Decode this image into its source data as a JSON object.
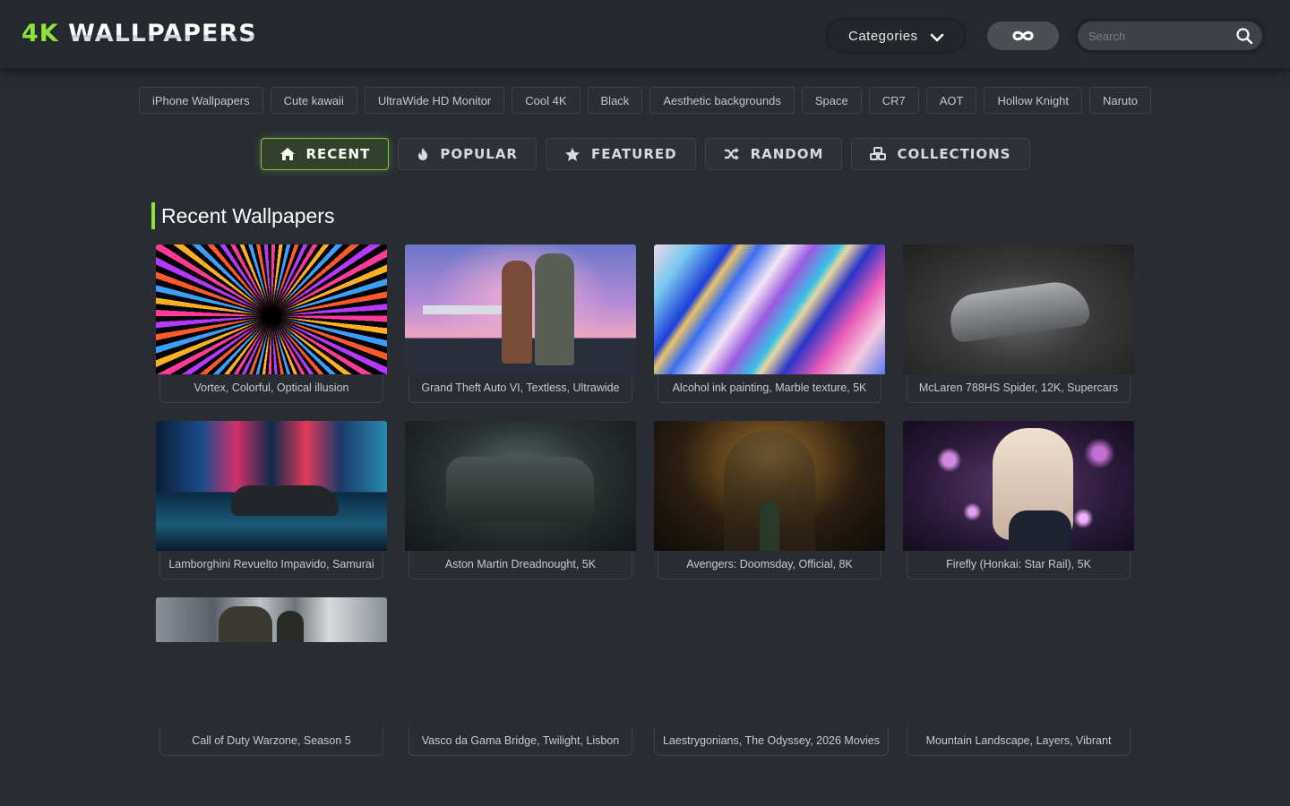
{
  "header": {
    "logo_accent": "4K",
    "logo_rest": "WALLPAPERS",
    "categories_label": "Categories",
    "search_placeholder": "Search"
  },
  "tags": [
    "iPhone Wallpapers",
    "Cute kawaii",
    "UltraWide HD Monitor",
    "Cool 4K",
    "Black",
    "Aesthetic backgrounds",
    "Space",
    "CR7",
    "AOT",
    "Hollow Knight",
    "Naruto"
  ],
  "nav_tabs": [
    {
      "label": "RECENT",
      "icon": "home-icon",
      "active": true
    },
    {
      "label": "POPULAR",
      "icon": "fire-icon",
      "active": false
    },
    {
      "label": "FEATURED",
      "icon": "star-icon",
      "active": false
    },
    {
      "label": "RANDOM",
      "icon": "shuffle-icon",
      "active": false
    },
    {
      "label": "COLLECTIONS",
      "icon": "collections-icon",
      "active": false
    }
  ],
  "section_title": "Recent Wallpapers",
  "wallpapers": [
    {
      "title": "Vortex, Colorful, Optical illusion"
    },
    {
      "title": "Grand Theft Auto VI, Textless, Ultrawide"
    },
    {
      "title": "Alcohol ink painting, Marble texture, 5K"
    },
    {
      "title": "McLaren 788HS Spider, 12K, Supercars"
    },
    {
      "title": "Lamborghini Revuelto Impavido, Samurai"
    },
    {
      "title": "Aston Martin Dreadnought, 5K"
    },
    {
      "title": "Avengers: Doomsday, Official, 8K"
    },
    {
      "title": "Firefly (Honkai: Star Rail), 5K"
    },
    {
      "title": "Call of Duty Warzone, Season 5"
    },
    {
      "title": "Vasco da Gama Bridge, Twilight, Lisbon"
    },
    {
      "title": "Laestrygonians, The Odyssey, 2026 Movies"
    },
    {
      "title": "Mountain Landscape, Layers, Vibrant"
    }
  ],
  "colors": {
    "accent": "#8ee23a",
    "background": "#292c33",
    "header": "#25282e"
  }
}
